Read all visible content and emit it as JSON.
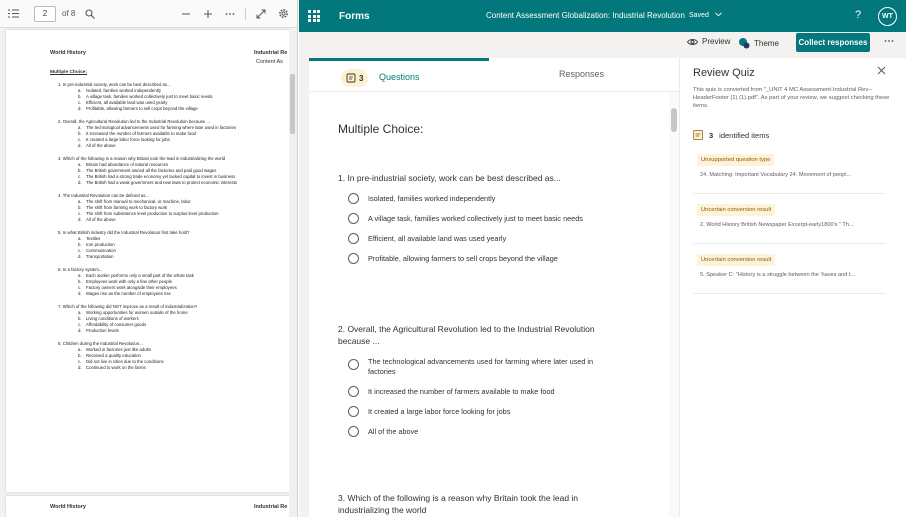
{
  "pdf_viewer": {
    "page_number": "2",
    "page_of": "of 8",
    "header_left": "World History",
    "header_right": "Industrial Re",
    "header_right2": "Content As",
    "section": "Multiple Choice:",
    "questions": [
      {
        "stem": "1.   In pre-industrial society, work can be best described as...",
        "options": [
          {
            "l": "a.",
            "t": "Isolated, families worked independently"
          },
          {
            "l": "b.",
            "t": "A village task, families worked collectively just to meet basic needs"
          },
          {
            "l": "c.",
            "t": "Efficient, all available land was used yearly"
          },
          {
            "l": "d.",
            "t": "Profitable, allowing farmers to sell crops beyond the village"
          }
        ]
      },
      {
        "stem": "2.   Overall, the Agricultural Revolution led to the Industrial Revolution because ...",
        "options": [
          {
            "l": "a.",
            "t": "The technological advancements used for farming where later used in factories"
          },
          {
            "l": "b.",
            "t": "It increased the number of farmers available to make food"
          },
          {
            "l": "c.",
            "t": "It created a large labor force looking for jobs"
          },
          {
            "l": "d.",
            "t": "All of the above"
          }
        ]
      },
      {
        "stem": "3.   Which of the following is a reason why Britain took the lead in industrializing the world",
        "options": [
          {
            "l": "a.",
            "t": "Britain had abundance of natural resources"
          },
          {
            "l": "b.",
            "t": "The British government owned all the factories and paid good wages"
          },
          {
            "l": "c.",
            "t": "The British had a strong trade economy yet lacked capital to invest in business"
          },
          {
            "l": "d.",
            "t": "The British had a weak government and new laws to protect economic interests"
          }
        ]
      },
      {
        "stem": "4.   The Industrial Revolution can be defined as...",
        "options": [
          {
            "l": "a.",
            "t": "The shift from manual to mechanical, or machine, labor"
          },
          {
            "l": "b.",
            "t": "The shift from farming work to factory work"
          },
          {
            "l": "c.",
            "t": "The shift from subsistence level production to surplus level production"
          },
          {
            "l": "d.",
            "t": "All of the above"
          }
        ]
      },
      {
        "stem": "5.   In what British industry did the Industrial Revolution first take hold?",
        "options": [
          {
            "l": "a.",
            "t": "Textiles"
          },
          {
            "l": "b.",
            "t": "Iron production"
          },
          {
            "l": "c.",
            "t": "Communication"
          },
          {
            "l": "d.",
            "t": "Transportation"
          }
        ]
      },
      {
        "stem": "6.   In a factory system...",
        "options": [
          {
            "l": "a.",
            "t": "Each worker performs only a small part of the whole task"
          },
          {
            "l": "b.",
            "t": "Employees work with only a few other people"
          },
          {
            "l": "c.",
            "t": "Factory owners work alongside their employees"
          },
          {
            "l": "d.",
            "t": "Wages rise as the number of employees rise"
          }
        ]
      },
      {
        "stem": "7.   Which of the following did NOT improve as a result of industrialization?",
        "options": [
          {
            "l": "a.",
            "t": "Working opportunities for women outside of the home"
          },
          {
            "l": "b.",
            "t": "Living conditions of workers"
          },
          {
            "l": "c.",
            "t": "Affordability of consumer goods"
          },
          {
            "l": "d.",
            "t": "Production levels"
          }
        ]
      },
      {
        "stem": "8.   Children during the Industrial Revolution...",
        "options": [
          {
            "l": "a.",
            "t": "Worked in factories just like adults"
          },
          {
            "l": "b.",
            "t": "Received a quality education"
          },
          {
            "l": "c.",
            "t": "Did not live in cities due to the conditions"
          },
          {
            "l": "d.",
            "t": "Continued to work on the farms"
          }
        ]
      }
    ],
    "next_page_header_left": "World History",
    "next_page_header_right": "Industrial Re"
  },
  "forms": {
    "app_name": "Forms",
    "doc_title": "Content Assessment Globalization: Industrial Revolution",
    "saved": "Saved",
    "help": "?",
    "avatar": "WT",
    "preview": "Preview",
    "theme": "Theme",
    "collect": "Collect responses",
    "tabs": {
      "question_count": "3",
      "questions": "Questions",
      "responses": "Responses"
    },
    "section_title": "Multiple Choice:",
    "questions": [
      {
        "stem": "1. In pre-industrial society, work can be best described as...",
        "options": [
          "Isolated, families worked independently",
          "A village task, families worked collectively just to meet basic needs",
          "Efficient, all available land was used yearly",
          "Profitable, allowing farmers to sell crops beyond the village"
        ]
      },
      {
        "stem": "2. Overall, the Agricultural Revolution led to the Industrial Revolution because ...",
        "options": [
          "The technological advancements used for farming where later used in factories",
          "It increased the number of farmers available to make food",
          "It created a large labor force looking for jobs",
          "All of the above"
        ]
      },
      {
        "stem": "3. Which of the following is a reason why Britain took the lead in industrializing the world",
        "options": []
      }
    ]
  },
  "review": {
    "title": "Review Quiz",
    "description": "This quiz is converted from \"_UNIT 4 MC Assessment-Industrial Rev--HeaderFooter (1) (1).pdf\". As part of your review, we suggest checking these items.",
    "count": "3",
    "count_label": "identified items",
    "items": [
      {
        "tag": "Unsupported question type",
        "text": "24. Matching: Important Vocabulary 24. Movement of peopl..."
      },
      {
        "tag": "Uncertain conversion result",
        "text": "2. World History British Newspaper Excerpt-early1800's \" Th..."
      },
      {
        "tag": "Uncertain conversion result",
        "text": "5. Speaker C: \"History is a struggle between the 'haves and t..."
      }
    ]
  },
  "colors": {
    "brand": "#03787c",
    "tag_bg": "#fdf3d8",
    "tag_text": "#8a5c00"
  }
}
